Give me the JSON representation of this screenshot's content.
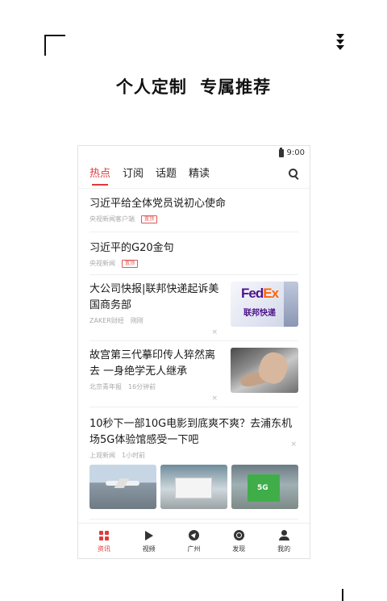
{
  "headline": "个人定制  专属推荐",
  "status": {
    "time": "9:00"
  },
  "tabs": [
    {
      "label": "热点",
      "active": true
    },
    {
      "label": "订阅"
    },
    {
      "label": "话题"
    },
    {
      "label": "精读"
    }
  ],
  "feed": [
    {
      "title": "习近平给全体党员说初心使命",
      "source": "央视新闻客户端",
      "badge": "置顶"
    },
    {
      "title": "习近平的G20金句",
      "source": "央视新闻",
      "badge": "置顶"
    },
    {
      "title": "大公司快报|联邦快递起诉美国商务部",
      "source": "ZAKER财经",
      "time": "刚刚",
      "close": "×",
      "thumb_logo_a": "Fed",
      "thumb_logo_b": "Ex",
      "thumb_caption": "联邦快递"
    },
    {
      "title": "故宫第三代摹印传人猝然离去 一身绝学无人继承",
      "source": "北京青年报",
      "time": "16分钟前",
      "close": "×"
    },
    {
      "title": "10秒下一部10G电影到底爽不爽？去浦东机场5G体验馆感受一下吧",
      "source": "上观新闻",
      "time": "1小时前",
      "close": "×",
      "img_text": "5G"
    }
  ],
  "bottom_nav": [
    {
      "label": "资讯",
      "icon": "grid-icon",
      "active": true
    },
    {
      "label": "视频",
      "icon": "play-icon"
    },
    {
      "label": "广州",
      "icon": "location-icon"
    },
    {
      "label": "发现",
      "icon": "discover-icon"
    },
    {
      "label": "我的",
      "icon": "user-icon"
    }
  ],
  "colors": {
    "accent": "#e03b3b"
  }
}
